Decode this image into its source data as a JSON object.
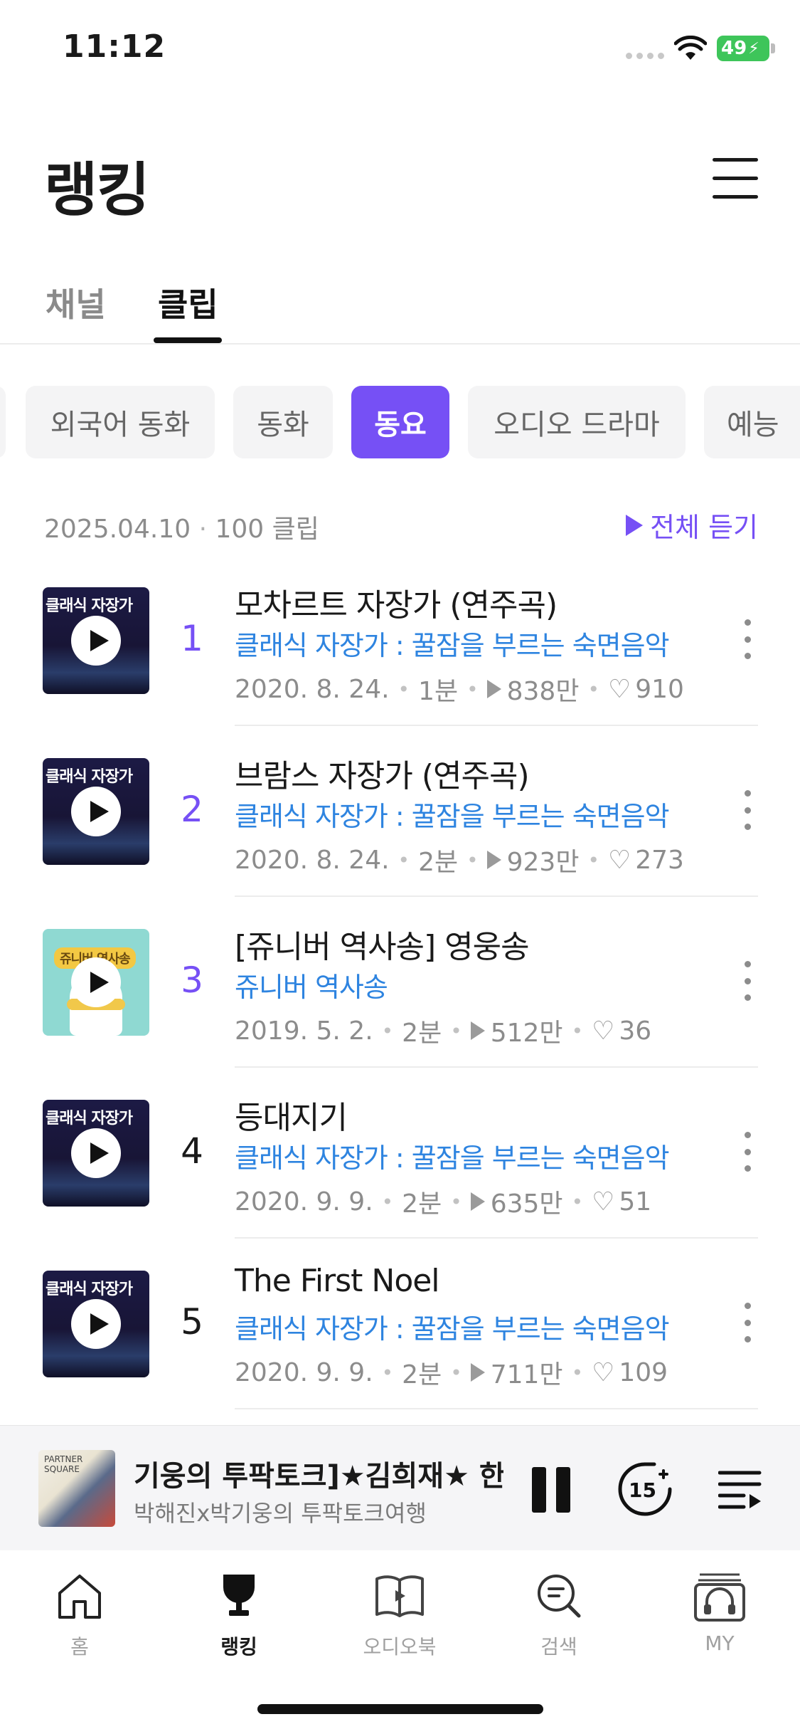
{
  "status": {
    "time": "11:12",
    "battery": "49"
  },
  "header": {
    "title": "랭킹"
  },
  "tabs": [
    {
      "label": "채널"
    },
    {
      "label": "클립"
    }
  ],
  "categories": [
    "외국어 동화",
    "동화",
    "동요",
    "오디오 드라마",
    "예능"
  ],
  "meta": {
    "date": "2025.04.10",
    "separator": "·",
    "count": "100 클립",
    "play_all": "전체 듣기"
  },
  "items": [
    {
      "rank": "1",
      "title": "모차르트 자장가 (연주곡)",
      "channel": "클래식 자장가 : 꿀잠을 부르는 숙면음악",
      "date": "2020. 8. 24.",
      "duration": "1분",
      "plays": "838만",
      "likes": "910",
      "thumb_label": "클래식 자장가"
    },
    {
      "rank": "2",
      "title": "브람스 자장가 (연주곡)",
      "channel": "클래식 자장가 : 꿀잠을 부르는 숙면음악",
      "date": "2020. 8. 24.",
      "duration": "2분",
      "plays": "923만",
      "likes": "273",
      "thumb_label": "클래식 자장가"
    },
    {
      "rank": "3",
      "title": "[쥬니버 역사송] 영웅송",
      "channel": "쥬니버 역사송",
      "date": "2019. 5. 2.",
      "duration": "2분",
      "plays": "512만",
      "likes": "36",
      "thumb_label": "쥬니버 역사송"
    },
    {
      "rank": "4",
      "title": "등대지기",
      "channel": "클래식 자장가 : 꿀잠을 부르는 숙면음악",
      "date": "2020. 9. 9.",
      "duration": "2분",
      "plays": "635만",
      "likes": "51",
      "thumb_label": "클래식 자장가"
    },
    {
      "rank": "5",
      "title": "The First Noel",
      "channel": "클래식 자장가 : 꿀잠을 부르는 숙면음악",
      "date": "2020. 9. 9.",
      "duration": "2분",
      "plays": "711만",
      "likes": "109",
      "thumb_label": "클래식 자장가"
    }
  ],
  "player": {
    "title": "기웅의 투팍토크]★김희재★ 한",
    "subtitle": "박해진x박기웅의 투팍토크여행",
    "skip_label": "15",
    "art_label": "PARTNER SQUARE"
  },
  "nav": [
    {
      "label": "홈",
      "icon": "home-icon"
    },
    {
      "label": "랭킹",
      "icon": "trophy-icon"
    },
    {
      "label": "오디오북",
      "icon": "book-icon"
    },
    {
      "label": "검색",
      "icon": "search-icon"
    },
    {
      "label": "MY",
      "icon": "headphones-icon"
    }
  ],
  "colors": {
    "accent": "#7650f5",
    "channel_link": "#2e84e0",
    "battery": "#3ec55a"
  }
}
